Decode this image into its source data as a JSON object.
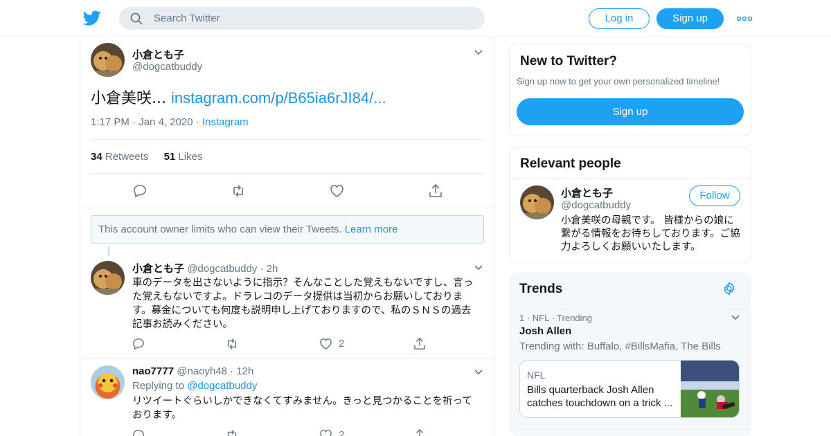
{
  "header": {
    "search_placeholder": "Search Twitter",
    "login_label": "Log in",
    "signup_label": "Sign up",
    "brand_color": "#1da1f2"
  },
  "main_tweet": {
    "name": "小倉とも子",
    "handle": "@dogcatbuddy",
    "text": "小倉美咲... ",
    "link": "instagram.com/p/B65ia6rJI84/...",
    "time": "1:17 PM",
    "sep": "·",
    "date": "Jan 4, 2020",
    "source": "Instagram",
    "retweets_count": "34",
    "retweets_label": "Retweets",
    "likes_count": "51",
    "likes_label": "Likes"
  },
  "notice": {
    "text": "This account owner limits who can view their Tweets. ",
    "link": "Learn more"
  },
  "replies": [
    {
      "name": "小倉とも子",
      "handle": "@dogcatbuddy",
      "time": "· 2h",
      "text": "車のデータを出さないように指示？そんなことした覚えもないですし、言った覚えもないですよ。ドラレコのデータ提供は当初からお願いしております。募金についても何度も説明申し上げておりますので、私のＳＮＳの過去記事お読みください。",
      "likes": "2"
    },
    {
      "name": "nao7777",
      "handle": "@naoyh48",
      "time": "· 12h",
      "replying_label": "Replying to ",
      "replying_to": "@dogcatbuddy",
      "text": "リツイートぐらいしかできなくてすみません。きっと見つかることを祈っております。",
      "likes": "2"
    }
  ],
  "sidebar": {
    "new_title": "New to Twitter?",
    "new_sub": "Sign up now to get your own personalized timeline!",
    "new_signup": "Sign up",
    "relevant_title": "Relevant people",
    "person_name": "小倉とも子",
    "person_handle": "@dogcatbuddy",
    "follow_label": "Follow",
    "person_bio": "小倉美咲の母親です。 皆様からの娘に繋がる情報をお待ちしております。ご協力よろしくお願いいたします。",
    "trends_title": "Trends",
    "trend_meta": "1 · NFL · Trending",
    "trend_name": "Josh Allen",
    "trend_with": "Trending with: Buffalo, #BillsMafia, The Bills",
    "card_source": "NFL",
    "card_headline": "Bills quarterback Josh Allen catches touchdown on a trick ..."
  }
}
